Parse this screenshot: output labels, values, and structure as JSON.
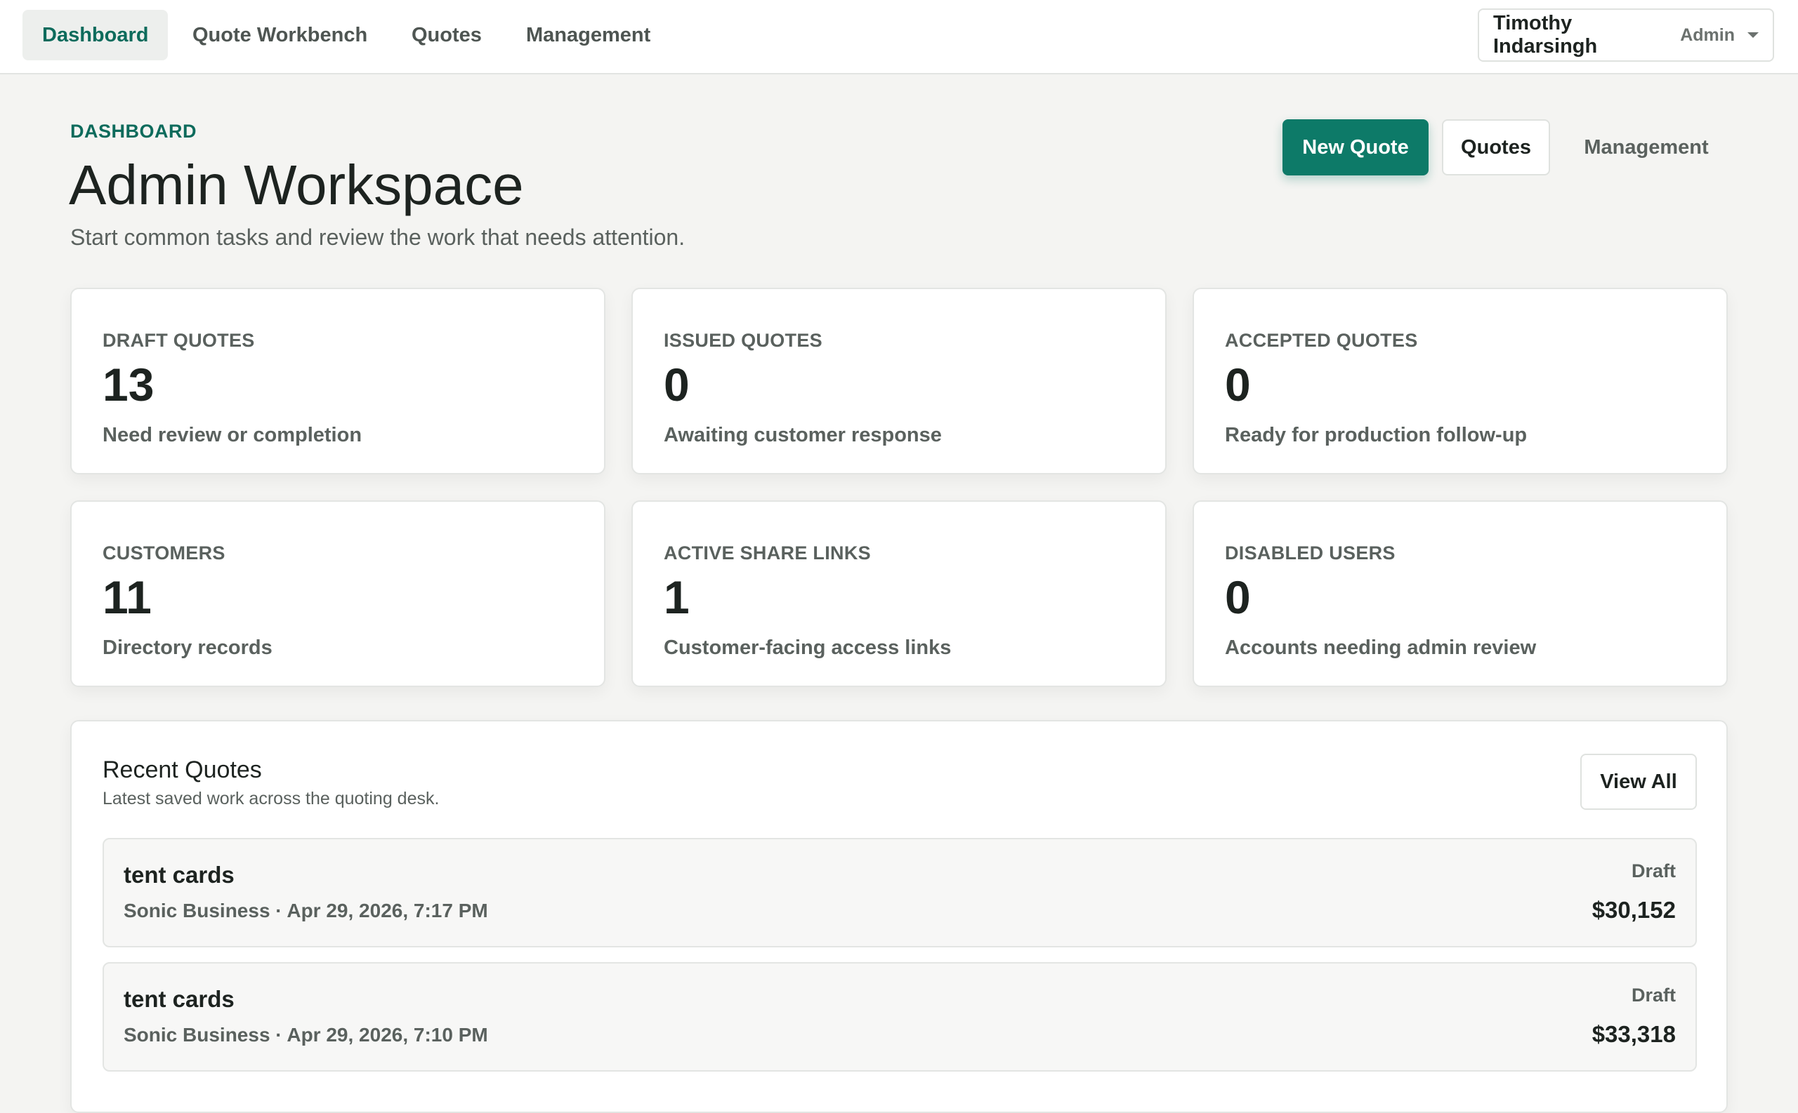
{
  "nav": {
    "tabs": [
      {
        "label": "Dashboard",
        "active": true
      },
      {
        "label": "Quote Workbench",
        "active": false
      },
      {
        "label": "Quotes",
        "active": false
      },
      {
        "label": "Management",
        "active": false
      }
    ],
    "user": {
      "name": "Timothy Indarsingh",
      "role": "Admin"
    }
  },
  "header": {
    "eyebrow": "DASHBOARD",
    "title": "Admin Workspace",
    "subtitle": "Start common tasks and review the work that needs attention.",
    "actions": {
      "new_quote": "New Quote",
      "quotes": "Quotes",
      "management": "Management"
    }
  },
  "stats": [
    {
      "label": "DRAFT QUOTES",
      "value": "13",
      "desc": "Need review or completion"
    },
    {
      "label": "ISSUED QUOTES",
      "value": "0",
      "desc": "Awaiting customer response"
    },
    {
      "label": "ACCEPTED QUOTES",
      "value": "0",
      "desc": "Ready for production follow-up"
    },
    {
      "label": "CUSTOMERS",
      "value": "11",
      "desc": "Directory records"
    },
    {
      "label": "ACTIVE SHARE LINKS",
      "value": "1",
      "desc": "Customer-facing access links"
    },
    {
      "label": "DISABLED USERS",
      "value": "0",
      "desc": "Accounts needing admin review"
    }
  ],
  "recent": {
    "title": "Recent Quotes",
    "subtitle": "Latest saved work across the quoting desk.",
    "view_all": "View All",
    "items": [
      {
        "name": "tent cards",
        "meta": "Sonic Business · Apr 29, 2026, 7:17 PM",
        "status": "Draft",
        "amount": "$30,152"
      },
      {
        "name": "tent cards",
        "meta": "Sonic Business · Apr 29, 2026, 7:10 PM",
        "status": "Draft",
        "amount": "$33,318"
      }
    ]
  },
  "colors": {
    "accent": "#0d7a68",
    "background": "#f4f4f2"
  }
}
